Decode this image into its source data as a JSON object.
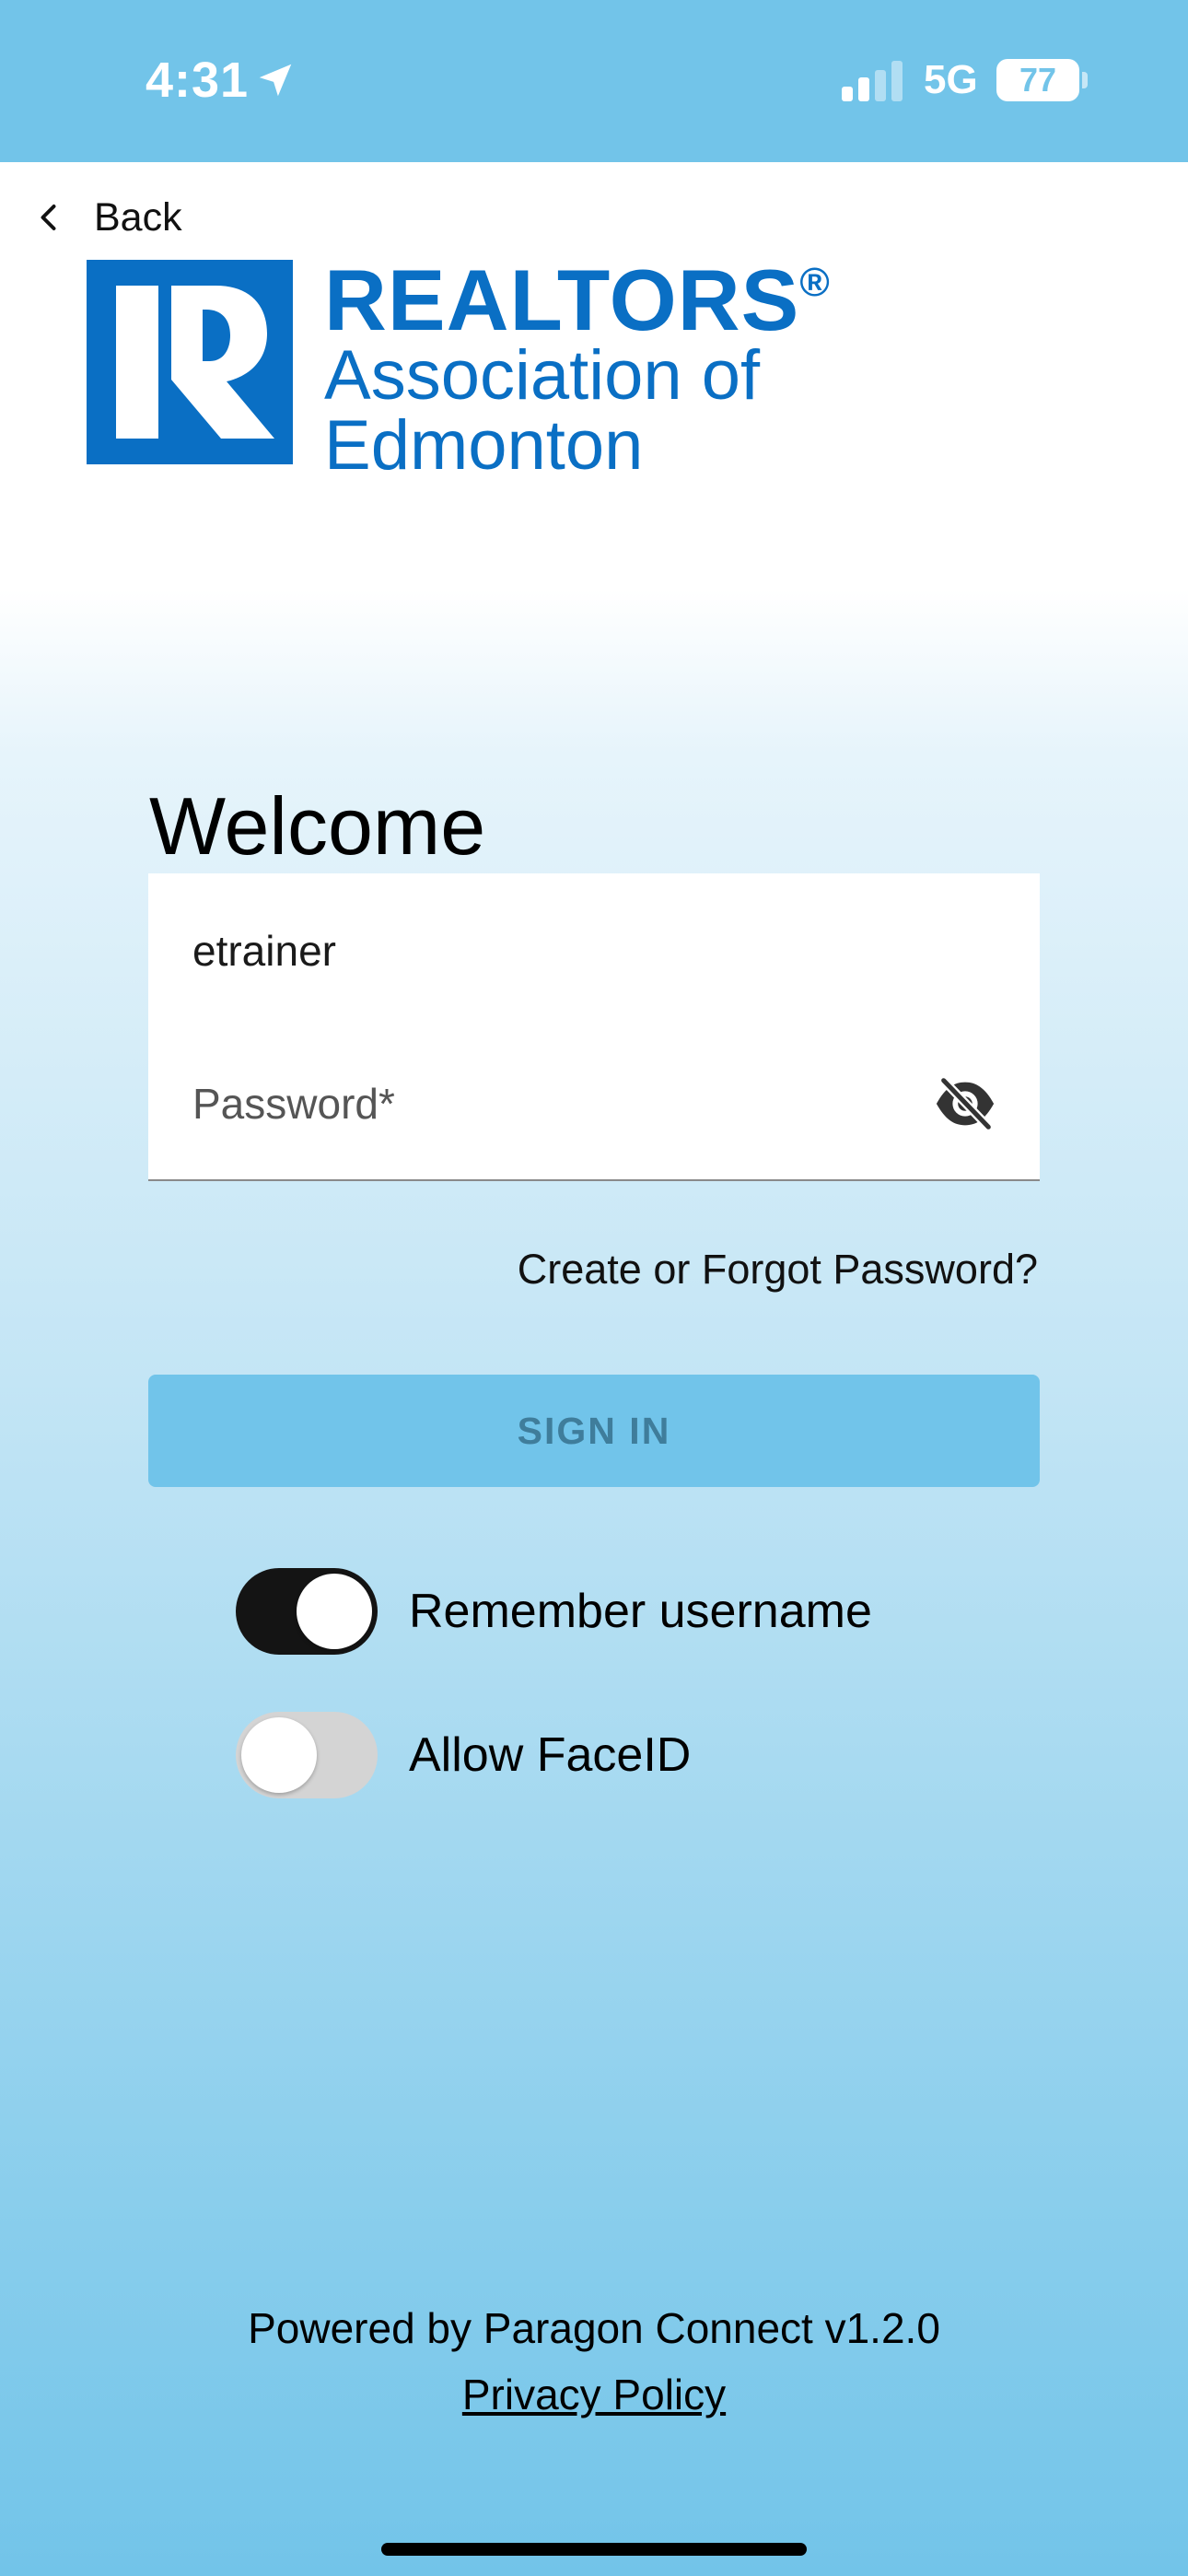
{
  "status_bar": {
    "time": "4:31",
    "network": "5G",
    "battery": "77"
  },
  "nav": {
    "back_label": "Back"
  },
  "logo": {
    "line1": "REALTORS",
    "registered": "®",
    "line2": "Association of",
    "line3": "Edmonton"
  },
  "login": {
    "title": "Welcome",
    "username_value": "etrainer",
    "password_placeholder": "Password*",
    "forgot_label": "Create or Forgot Password?",
    "sign_in_label": "SIGN IN"
  },
  "options": {
    "remember_label": "Remember username",
    "remember_on": true,
    "faceid_label": "Allow FaceID",
    "faceid_on": false
  },
  "footer": {
    "powered_by": "Powered by Paragon Connect v1.2.0",
    "privacy_label": "Privacy Policy"
  },
  "colors": {
    "status_bar": "#72c4e9",
    "brand_blue": "#0a6fc4",
    "sign_in_bg": "#71c4ea"
  }
}
